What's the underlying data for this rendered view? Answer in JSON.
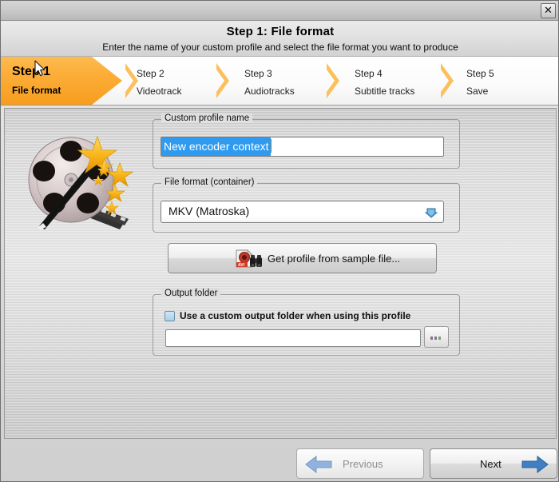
{
  "window": {
    "close_label": "✕"
  },
  "header": {
    "title": "Step 1: File format",
    "subtitle": "Enter the name of your custom profile and select the file format you want to produce"
  },
  "steps": [
    {
      "title": "Step 1",
      "sub": "File format",
      "active": true
    },
    {
      "title": "Step 2",
      "sub": "Videotrack",
      "active": false
    },
    {
      "title": "Step 3",
      "sub": "Audiotracks",
      "active": false
    },
    {
      "title": "Step 4",
      "sub": "Subtitle tracks",
      "active": false
    },
    {
      "title": "Step 5",
      "sub": "Save",
      "active": false
    }
  ],
  "form": {
    "profile_group_label": "Custom profile name",
    "profile_value": "New encoder context",
    "profile_placeholder": "",
    "format_group_label": "File format (container)",
    "format_value": "MKV (Matroska)",
    "sample_button_label": "Get profile from sample file...",
    "output_group_label": "Output folder",
    "use_custom_folder_label": "Use a custom output folder when using this profile",
    "use_custom_folder_checked": false,
    "folder_value": "",
    "folder_placeholder": "",
    "browse_label": "..."
  },
  "footer": {
    "previous_label": "Previous",
    "next_label": "Next",
    "previous_enabled": false,
    "next_enabled": true
  },
  "colors": {
    "accent_orange": "#f79d1f",
    "chevron_orange": "#fcbf5b",
    "selection_blue": "#2e9bf0",
    "arrow_blue": "#3f7fc4",
    "arrow_blue_disabled": "#8fb3dc",
    "panel_gray": "#d9d9d9"
  }
}
